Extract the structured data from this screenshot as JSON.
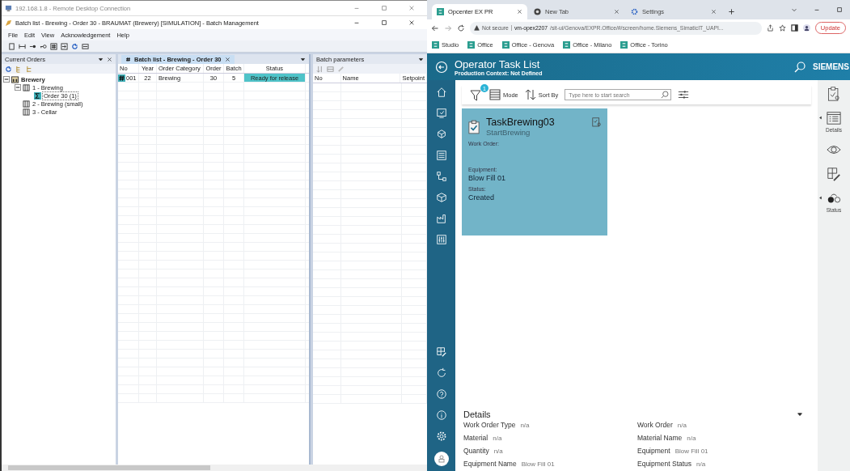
{
  "remote_window": {
    "title": "192.168.1.8 - Remote Desktop Connection"
  },
  "app_window": {
    "title": "Batch list - Brewing - Order 30 - BRAUMAT (Brewery) [SIMULATION] - Batch Management",
    "menu": [
      "File",
      "Edit",
      "View",
      "Acknowledgement",
      "Help"
    ]
  },
  "current_orders": {
    "title": "Current Orders",
    "tree": [
      {
        "label": "Brewery",
        "kind": "plant",
        "expanded": true,
        "children": [
          {
            "label": "1 - Brewing",
            "kind": "unit",
            "expanded": true,
            "children": [
              {
                "label": "Order 30 (1)",
                "kind": "order",
                "selected": true
              }
            ]
          },
          {
            "label": "2 - Brewing (small)",
            "kind": "unit"
          },
          {
            "label": "3 - Cellar",
            "kind": "unit"
          }
        ]
      }
    ]
  },
  "batch_list": {
    "tab": "Batch list - Brewing - Order 30",
    "columns": [
      "No",
      "Year",
      "Order Category",
      "Order",
      "Batch",
      "Status"
    ],
    "rows": [
      {
        "cells": [
          "001",
          "22",
          "Brewing",
          "30",
          "5",
          "Ready for release"
        ]
      }
    ]
  },
  "batch_parameters": {
    "title": "Batch parameters",
    "columns": [
      "No",
      "Name",
      "Setpoint"
    ]
  },
  "browser": {
    "tabs": [
      {
        "title": "Opcenter EX PR",
        "kind": "app",
        "selected": true
      },
      {
        "title": "New Tab",
        "kind": "newtab",
        "selected": false
      },
      {
        "title": "Settings",
        "kind": "settings",
        "selected": false
      }
    ],
    "security": "Not secure",
    "url_host": "vm-opex2207",
    "url_path": "/sit-ui/Genova/EXPR.Office/#/screen/home.Siemens_SimaticIT_UAPI...",
    "update_button": "Update",
    "bookmarks": [
      "Studio",
      "Office",
      "Office - Genova",
      "Office - Milano",
      "Office - Torino"
    ]
  },
  "app": {
    "title": "Operator Task List",
    "context": "Production Context: Not Defined",
    "brand": "SIEMENS",
    "filter_badge": "1",
    "mode": "Mode",
    "sort": "Sort By",
    "search": {
      "placeholder": "Type here to start search"
    },
    "card": {
      "title": "TaskBrewing03",
      "subtitle": "StartBrewing",
      "fields": [
        {
          "label": "Work Order:"
        },
        {
          "label": "Equipment:",
          "value": "Blow Fill 01"
        },
        {
          "label": "Status:",
          "value": "Created"
        }
      ]
    },
    "rail": [
      {
        "kind": "clipboard"
      },
      {
        "kind": "list",
        "label": "Details"
      },
      {
        "kind": "eye"
      },
      {
        "kind": "grid"
      },
      {
        "kind": "status",
        "label": "Status"
      }
    ],
    "details": {
      "title": "Details",
      "fields": [
        {
          "label": "Work Order Type",
          "value": "n/a"
        },
        {
          "label": "Work Order",
          "value": "n/a"
        },
        {
          "label": "Material",
          "value": "n/a"
        },
        {
          "label": "Material Name",
          "value": "n/a"
        },
        {
          "label": "Quantity",
          "value": "n/a"
        },
        {
          "label": "Equipment",
          "value": "Blow Fill 01"
        },
        {
          "label": "Equipment Name",
          "value": "Blow Fill 01"
        },
        {
          "label": "Equipment Status",
          "value": "n/a"
        }
      ]
    }
  }
}
